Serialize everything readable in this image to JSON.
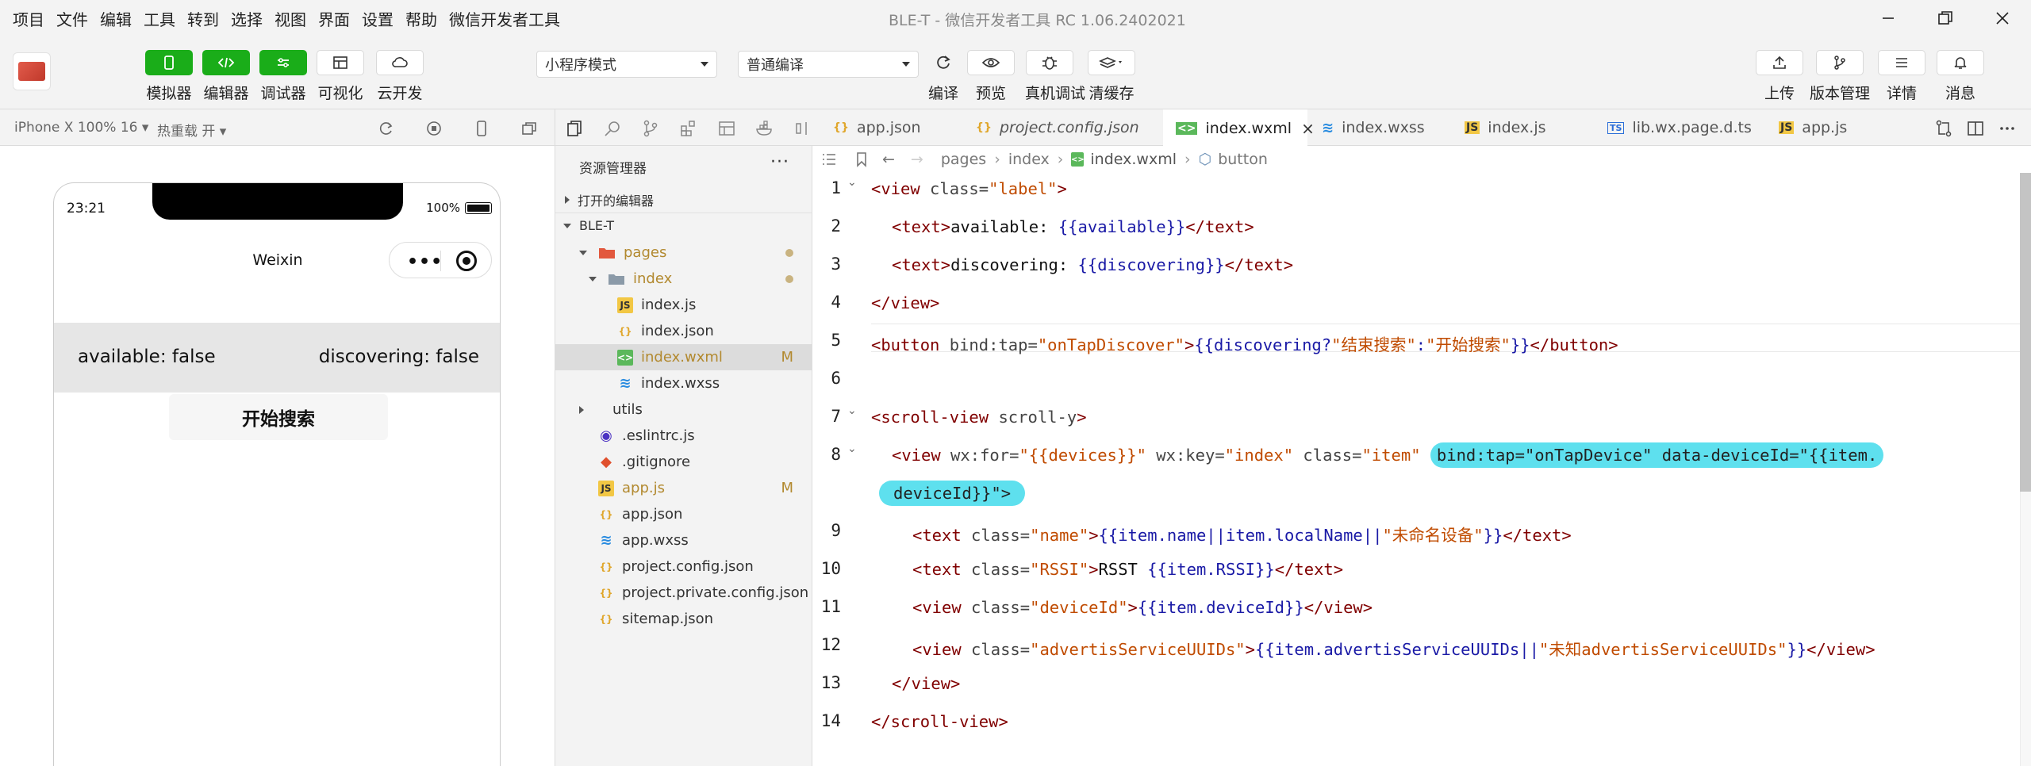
{
  "window": {
    "menus": [
      "项目",
      "文件",
      "编辑",
      "工具",
      "转到",
      "选择",
      "视图",
      "界面",
      "设置",
      "帮助",
      "微信开发者工具"
    ],
    "title": "BLE-T - 微信开发者工具 RC 1.06.2402021"
  },
  "toolbar": {
    "left_buttons": [
      "模拟器",
      "编辑器",
      "调试器",
      "可视化",
      "云开发"
    ],
    "mode_select": "小程序模式",
    "compile_select": "普通编译",
    "mid_buttons": [
      "编译",
      "预览",
      "真机调试",
      "清缓存"
    ],
    "right_buttons": [
      "上传",
      "版本管理",
      "详情",
      "消息"
    ]
  },
  "simulator_bar": {
    "device": "iPhone X 100% 16",
    "hot_reload": "热重载 开"
  },
  "phone": {
    "time": "23:21",
    "battery": "100%",
    "nav_title": "Weixin",
    "capsule_dots": "•••",
    "available_text": "available: false",
    "discovering_text": "discovering: false",
    "button_text": "开始搜索"
  },
  "explorer": {
    "title": "资源管理器",
    "more": "···",
    "open_editors": "打开的编辑器",
    "project": "BLE-T",
    "tree": [
      {
        "name": "pages",
        "icon": "folder-icon"
      },
      {
        "name": "index",
        "icon": "folder-icon"
      },
      {
        "name": "index.js",
        "icon": "js-file-icon"
      },
      {
        "name": "index.json",
        "icon": "json-file-icon"
      },
      {
        "name": "index.wxml",
        "icon": "wxml-file-icon",
        "flag": "M"
      },
      {
        "name": "index.wxss",
        "icon": "wxss-file-icon"
      },
      {
        "name": "utils",
        "icon": "folder-icon"
      },
      {
        "name": ".eslintrc.js",
        "icon": "eslint-file-icon"
      },
      {
        "name": ".gitignore",
        "icon": "git-file-icon"
      },
      {
        "name": "app.js",
        "icon": "js-file-icon",
        "flag": "M"
      },
      {
        "name": "app.json",
        "icon": "json-file-icon"
      },
      {
        "name": "app.wxss",
        "icon": "wxss-file-icon"
      },
      {
        "name": "project.config.json",
        "icon": "json-file-icon"
      },
      {
        "name": "project.private.config.json",
        "icon": "json-file-icon"
      },
      {
        "name": "sitemap.json",
        "icon": "json-file-icon"
      }
    ]
  },
  "tabs": [
    {
      "label": "app.json",
      "icon": "json-file-icon"
    },
    {
      "label": "project.config.json",
      "icon": "json-file-icon"
    },
    {
      "label": "index.wxml",
      "icon": "wxml-file-icon",
      "close": "×"
    },
    {
      "label": "index.wxss",
      "icon": "wxss-file-icon"
    },
    {
      "label": "index.js",
      "icon": "js-file-icon"
    },
    {
      "label": "lib.wx.page.d.ts",
      "icon": "ts-file-icon"
    },
    {
      "label": "app.js",
      "icon": "js-file-icon"
    }
  ],
  "breadcrumb": [
    "pages",
    "index",
    "index.wxml",
    "button"
  ],
  "editor": {
    "line_numbers": [
      "1",
      "2",
      "3",
      "4",
      "5",
      "6",
      "7",
      "8",
      "9",
      "10",
      "11",
      "12",
      "13",
      "14"
    ],
    "code": {
      "l1": [
        "<view",
        " class=",
        "\"label\"",
        ">"
      ],
      "l2": [
        "<text>",
        "available: ",
        "{{available}}",
        "</text>"
      ],
      "l3": [
        "<text>",
        "discovering: ",
        "{{discovering}}",
        "</text>"
      ],
      "l4": [
        "</view>"
      ],
      "l5": [
        "<button",
        " bind:tap=",
        "\"onTapDiscover\"",
        ">",
        "{{discovering?",
        "\"结束搜索\"",
        ":",
        "\"开始搜索\"",
        "}}",
        "</button>"
      ],
      "l7": [
        "<scroll-view",
        " scroll-y",
        ">"
      ],
      "l8a": [
        "<view",
        " wx:for=",
        "\"{{devices}}\"",
        " wx:key=",
        "\"index\"",
        " class=",
        "\"item\"",
        " "
      ],
      "l8b": [
        "bind:tap=\"onTapDevice\" data-deviceId=\"{{item."
      ],
      "l8c": [
        "deviceId}}\">"
      ],
      "l9": [
        "<text",
        " class=",
        "\"name\"",
        ">",
        "{{item.name||item.localName||",
        "\"未命名设备\"",
        "}}",
        "</text>"
      ],
      "l10": [
        "<text",
        " class=",
        "\"RSSI\"",
        ">",
        "RSST ",
        "{{item.RSSI}}",
        "</text>"
      ],
      "l11": [
        "<view",
        " class=",
        "\"deviceId\"",
        ">",
        "{{item.deviceId}}",
        "</view>"
      ],
      "l12": [
        "<view",
        " class=",
        "\"advertisServiceUUIDs\"",
        ">",
        "{{item.advertisServiceUUIDs||",
        "\"未知advertisServiceUUIDs\"",
        "}}",
        "</view>"
      ],
      "l13": [
        "</view>"
      ],
      "l14": [
        "</scroll-view>"
      ]
    }
  },
  "colors": {
    "accent_green": "#1aad19",
    "tag": "#800000",
    "string": "#c04b00",
    "expression": "#1a1aa6",
    "highlight": "#5ee0ee"
  }
}
